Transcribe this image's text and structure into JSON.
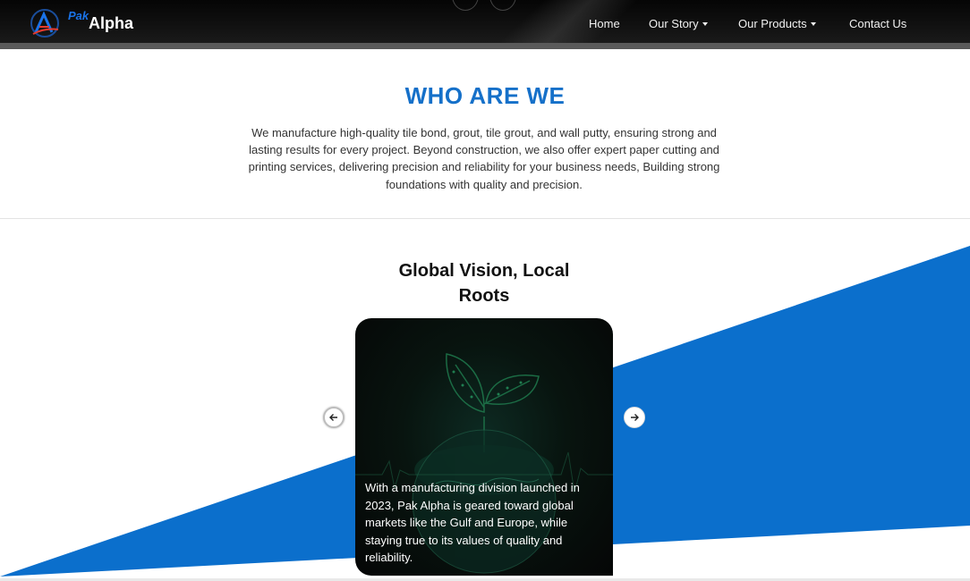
{
  "brand": {
    "small_text": "Pak",
    "main_text": "Alpha",
    "accent_color": "#1570c9"
  },
  "nav": {
    "items": [
      {
        "label": "Home",
        "has_dropdown": false
      },
      {
        "label": "Our Story",
        "has_dropdown": true
      },
      {
        "label": "Our Products",
        "has_dropdown": true
      },
      {
        "label": "Contact Us",
        "has_dropdown": false
      }
    ]
  },
  "about": {
    "title": "WHO ARE WE",
    "body": "We manufacture high-quality tile bond, grout, tile grout, and wall putty, ensuring strong and lasting results for every project. Beyond construction, we also offer expert paper cutting and printing services, delivering precision and reliability for your business needs, Building strong foundations with quality and precision."
  },
  "vision": {
    "title": "Global Vision, Local Roots",
    "card_text": "With a manufacturing division launched in 2023, Pak Alpha is geared toward global markets like the Gulf and Europe, while staying true to its values of quality and reliability.",
    "prev_icon": "arrow-left-icon",
    "next_icon": "arrow-right-icon"
  },
  "colors": {
    "blue": "#0b6fcc",
    "navbar": "#0a0a0a",
    "title_blue": "#1570c9"
  }
}
